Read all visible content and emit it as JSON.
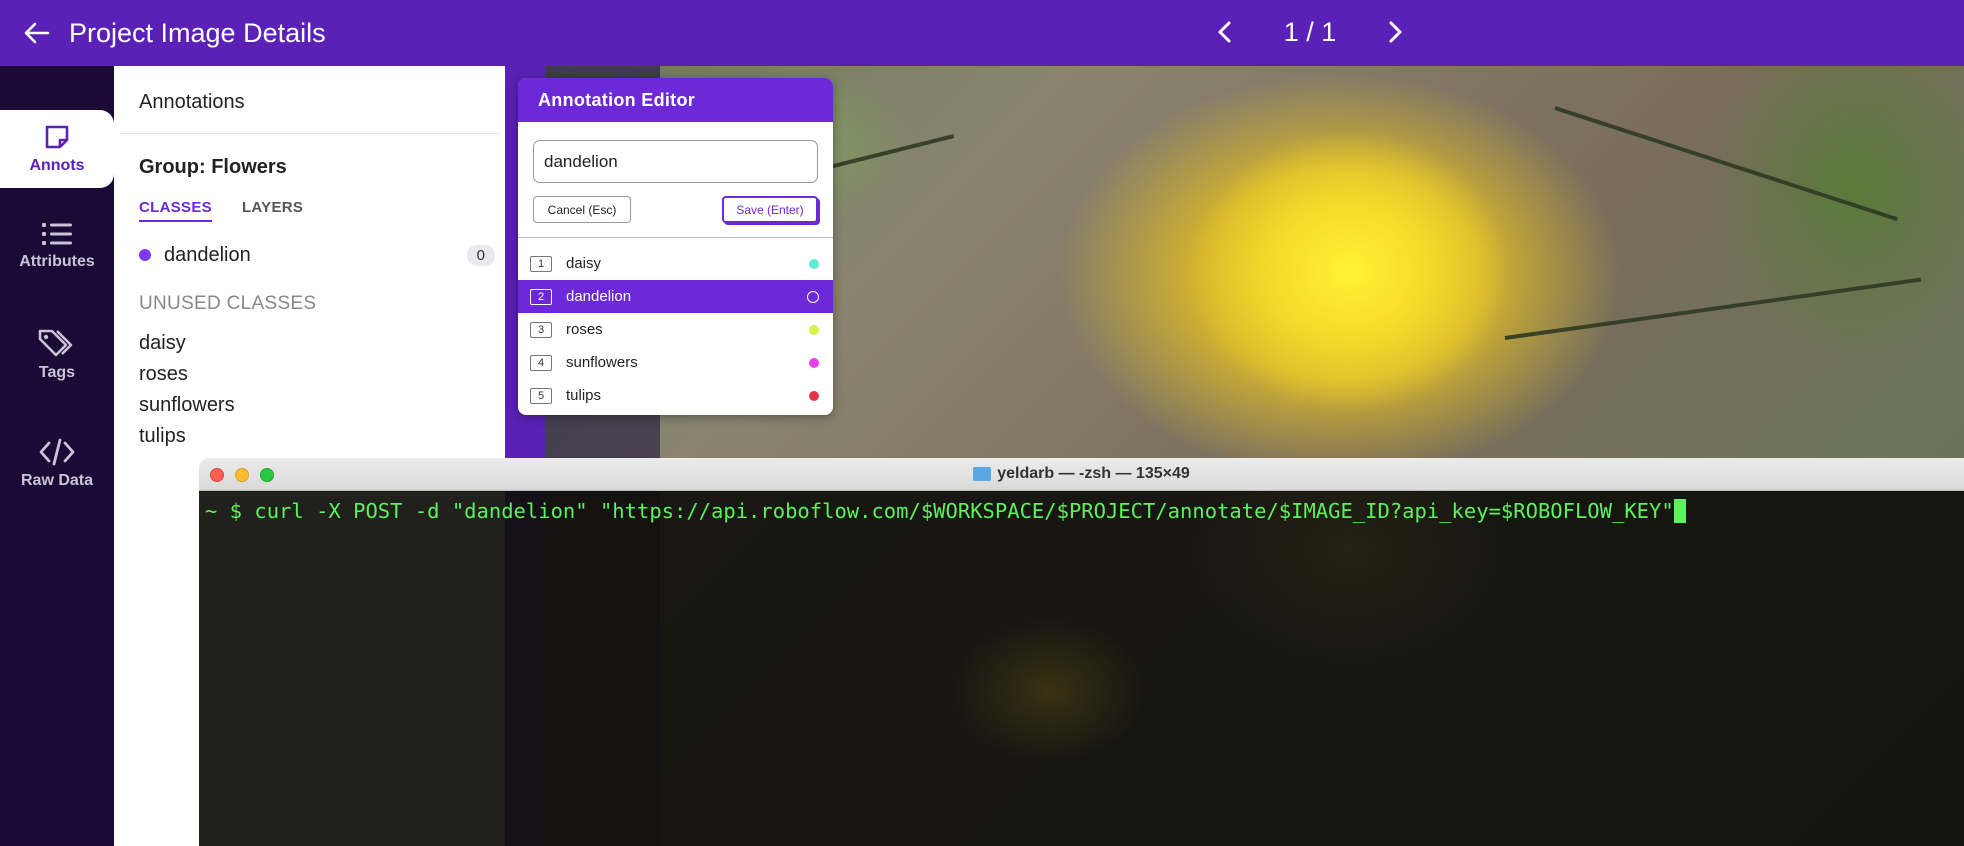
{
  "header": {
    "title": "Project Image Details",
    "pager": "1 / 1"
  },
  "rail": {
    "items": [
      {
        "label": "Annots",
        "icon": "note-icon"
      },
      {
        "label": "Attributes",
        "icon": "list-icon"
      },
      {
        "label": "Tags",
        "icon": "tags-icon"
      },
      {
        "label": "Raw Data",
        "icon": "code-icon"
      }
    ]
  },
  "panel": {
    "title": "Annotations",
    "group_title": "Group: Flowers",
    "tabs": [
      "CLASSES",
      "LAYERS"
    ],
    "classes": [
      {
        "name": "dandelion",
        "count": "0",
        "color": "#7c3aed"
      }
    ],
    "unused_title": "UNUSED CLASSES",
    "unused": [
      "daisy",
      "roses",
      "sunflowers",
      "tulips"
    ]
  },
  "editor": {
    "title": "Annotation Editor",
    "input_value": "dandelion",
    "cancel_label": "Cancel (Esc)",
    "save_label": "Save (Enter)",
    "options": [
      {
        "num": "1",
        "label": "daisy",
        "color": "#5eead4"
      },
      {
        "num": "2",
        "label": "dandelion",
        "color": "#ffffff"
      },
      {
        "num": "3",
        "label": "roses",
        "color": "#d9f24a"
      },
      {
        "num": "4",
        "label": "sunflowers",
        "color": "#e940e9"
      },
      {
        "num": "5",
        "label": "tulips",
        "color": "#e0344a"
      }
    ],
    "selected_index": 1
  },
  "terminal": {
    "title": "yeldarb — -zsh — 135×49",
    "command": "~ $ curl -X POST -d \"dandelion\" \"https://api.roboflow.com/$WORKSPACE/$PROJECT/annotate/$IMAGE_ID?api_key=$ROBOFLOW_KEY\""
  },
  "colors": {
    "brand": "#5b21b6",
    "accent": "#6d28d9",
    "terminal_text": "#5cf25c"
  }
}
